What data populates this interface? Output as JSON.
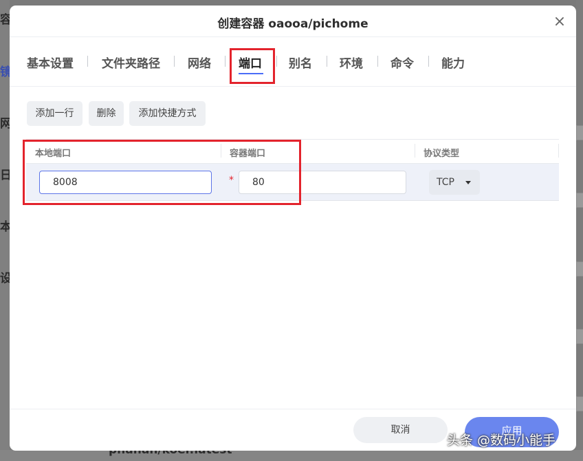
{
  "background": {
    "sidebar_fragments": [
      "容器",
      "镜",
      "网",
      "日",
      "本",
      "设"
    ],
    "bottom_text": "phanan/koel:latest"
  },
  "modal": {
    "title": "创建容器 oaooa/pichome",
    "close_symbol": "×"
  },
  "tabs": [
    {
      "label": "基本设置",
      "active": false
    },
    {
      "label": "文件夹路径",
      "active": false
    },
    {
      "label": "网络",
      "active": false
    },
    {
      "label": "端口",
      "active": true
    },
    {
      "label": "别名",
      "active": false
    },
    {
      "label": "环境",
      "active": false
    },
    {
      "label": "命令",
      "active": false
    },
    {
      "label": "能力",
      "active": false
    }
  ],
  "toolbar": {
    "add_row": "添加一行",
    "delete": "删除",
    "add_shortcut": "添加快捷方式"
  },
  "port_table": {
    "headers": [
      "本地端口",
      "容器端口",
      "协议类型"
    ],
    "rows": [
      {
        "local_port": "8008",
        "required_mark": "*",
        "container_port": "80",
        "protocol": "TCP"
      }
    ]
  },
  "footer": {
    "cancel": "取消",
    "apply": "应用"
  },
  "watermark": "头条 @数码小能手",
  "colors": {
    "accent": "#4a6cf7",
    "highlight_box": "#e3232c",
    "apply_button": "#6a86ee"
  }
}
